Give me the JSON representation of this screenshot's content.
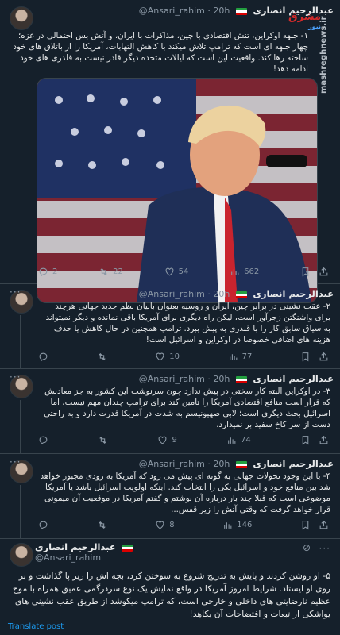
{
  "author": {
    "name": "عبدالرحیم انصاری",
    "handle": "@Ansari_rahim"
  },
  "tweets": [
    {
      "time": "20h",
      "text": "۱- جبهه اوکراین، تنش اقتصادی با چین، مذاکرات با ایران، و آتش بس احتمالی در غزه؛ چهار جبهه ای است که ترامپ تلاش میکند با کاهش التهابات، آمریکا را از باتلاق های خود ساخته رها کند. واقعیت این است که ایالات متحده دیگر قادر نیست به قلدری های خود ادامه دهد!",
      "stats": {
        "replies": "2",
        "retweets": "22",
        "likes": "54",
        "views": "662"
      }
    },
    {
      "time": "20h",
      "text": "۲- عقب نشینی در برابر چین، ایران و روسیه بعنوان بانیان نظم جدید جهانی هرچند برای واشنگتن زجرآور است، لیکن راه دیگری برای آمریکا باقی نمانده و دیگر نمیتواند به سیاق سابق کار را با قلدری به پیش ببرد. ترامپ همچنین در حال کاهش یا حذف هزینه های اضافی خصوصا در اوکراین و اسرائیل است!",
      "stats": {
        "replies": "",
        "retweets": "",
        "likes": "10",
        "views": "77"
      }
    },
    {
      "time": "20h",
      "text": "۳- در اوکراین البته کار سختی در پیش ندارد چون سرنوشت این کشور به جز معادنش که قرار است منافع اقتصادی آمریکا را تامین کند برای ترامپ چندان مهم نیست، اما اسرائیل بحث دیگری است؛ لابی صهیونیسم به شدت در آمریکا قدرت دارد و به راحتی دست از سر کاخ سفید بر نمیدارد.",
      "stats": {
        "replies": "",
        "retweets": "",
        "likes": "9",
        "views": "74"
      }
    },
    {
      "time": "20h",
      "text": "۴- با این وجود تحولات جهانی به گونه ای پیش می رود که آمریکا به زودی مجبور خواهد شد بین منافع خود و اسرائیل یکی را انتخاب کند. اینکه اولویت اسرائیل باشد یا آمریکا موضوعی است که قبلا چند بار درباره آن نوشتم و گفتم آمریکا در موقعیت آن میمونی قرار خواهد گرفت که وقتی آتش را زیر قفس...",
      "stats": {
        "replies": "",
        "retweets": "",
        "likes": "8",
        "views": "146"
      }
    },
    {
      "time": "",
      "text": "۵- او روشن کردند و پایش به تدریج شروع به سوختن کرد، بچه اش را زیر پا گذاشت و بر روی او ایستاد. شرایط امروز آمریکا در واقع نمایش یک نوع سردرگمی عمیق همراه با موج عظیم نارضایتی های داخلی و خارجی است، که ترامپ میکوشد از طریق عقب نشینی های یواشکی از تبعات و افتضاحات آن بکاهد!",
      "stats": {}
    }
  ],
  "footer": {
    "translate": "Translate post"
  },
  "watermark": {
    "site": "mashreghnews.ir",
    "logo": "مشرق",
    "logo_sub": "نیوز"
  }
}
